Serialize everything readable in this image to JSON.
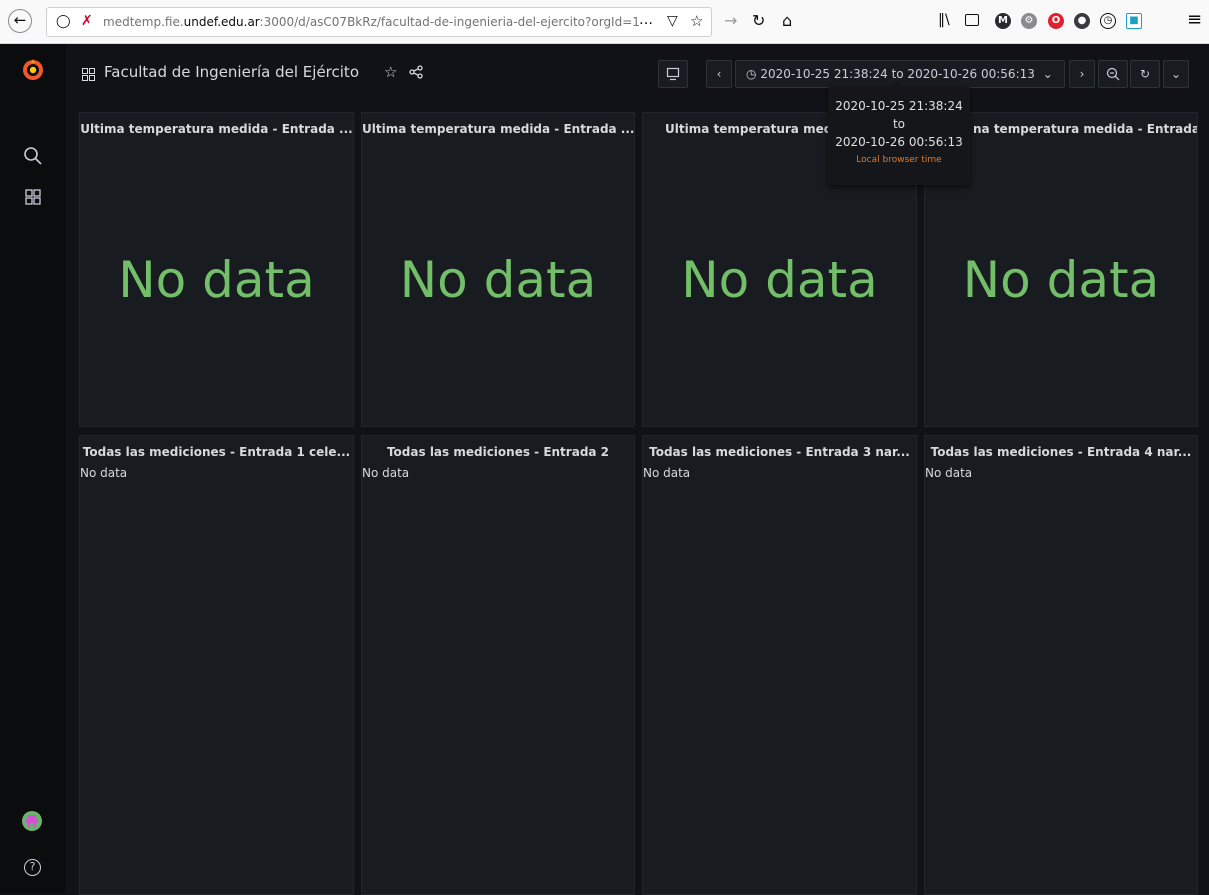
{
  "browser": {
    "url_prefix": "medtemp.fie.",
    "url_host": "undef.edu.ar",
    "url_suffix": ":3000/d/asC07BkRz/facultad-de-ingenieria-del-ejercito?orgId=1"
  },
  "icons": {
    "back": "arrow-left-icon",
    "shield": "tracking-shield-icon",
    "insecure": "insecure-lock-icon",
    "more": "more-actions-icon",
    "pocket": "pocket-icon",
    "star": "bookmark-star-icon",
    "forward": "arrow-right-icon",
    "reload": "reload-icon",
    "home": "home-icon",
    "library": "library-icon",
    "sidebar": "sidebar-icon",
    "menu": "hamburger-menu-icon"
  },
  "colors": {
    "stat_nodata": "#73bf69",
    "tooltip_zone": "#e07a2b",
    "background": "#111217",
    "panel": "#181b1f"
  },
  "dashboard": {
    "title": "Facultad de Ingeniería del Ejército"
  },
  "time_picker": {
    "range": "2020-10-25 21:38:24 to 2020-10-26 00:56:13"
  },
  "tooltip": {
    "from": "2020-10-25 21:38:24",
    "to_word": "to",
    "to": "2020-10-26 00:56:13",
    "zone": "Local browser time"
  },
  "stat_panels": [
    {
      "title": "Ultima temperatura medida - Entrada ...",
      "value": "No data"
    },
    {
      "title": "Ultima temperatura medida - Entrada ...",
      "value": "No data"
    },
    {
      "title": "Ultima temperatura medida",
      "value": "No data"
    },
    {
      "title": "na temperatura medida - Entrada ...",
      "value": "No data"
    }
  ],
  "timeseries_panels": [
    {
      "title": "Todas las mediciones - Entrada 1 cele...",
      "message": "No data"
    },
    {
      "title": "Todas las mediciones - Entrada 2",
      "message": "No data"
    },
    {
      "title": "Todas las mediciones - Entrada 3 nar...",
      "message": "No data"
    },
    {
      "title": "Todas las mediciones - Entrada 4 nar...",
      "message": "No data"
    }
  ]
}
